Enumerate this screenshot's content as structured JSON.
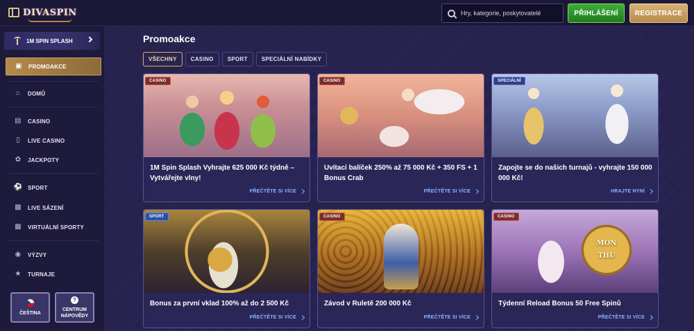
{
  "header": {
    "logo_text": "DIVASPIN",
    "search_placeholder": "Hry, kategorie, poskytovatelé",
    "login_label": "PŘIHLÁŠENÍ",
    "register_label": "REGISTRACE"
  },
  "sidebar": {
    "promo_banner": "1M SPIN SPLASH",
    "items": [
      {
        "label": "PROMOAKCE",
        "icon": "gift-icon"
      },
      {
        "label": "DOMŮ",
        "icon": "home-icon"
      },
      {
        "label": "CASINO",
        "icon": "slot-machine-icon"
      },
      {
        "label": "LIVE CASINO",
        "icon": "live-casino-icon"
      },
      {
        "label": "JACKPOTY",
        "icon": "jackpot-icon"
      },
      {
        "label": "SPORT",
        "icon": "ball-icon"
      },
      {
        "label": "LIVE SÁZENÍ",
        "icon": "live-betting-icon"
      },
      {
        "label": "VIRTUÁLNÍ SPORTY",
        "icon": "virtual-sports-icon"
      },
      {
        "label": "VÝZVY",
        "icon": "challenge-icon"
      },
      {
        "label": "TURNAJE",
        "icon": "trophy-icon"
      }
    ],
    "language_label": "ČEŠTINA",
    "help_label": "CENTRUM NÁPOVĚDY"
  },
  "main": {
    "title": "Promoakce",
    "filters": [
      "VŠECHNY",
      "CASINO",
      "SPORT",
      "SPECIÁLNÍ NABÍDKY"
    ],
    "cards": [
      {
        "badge": "CASINO",
        "title": "1M Spin Splash Vyhrajte 625 000 Kč týdně – Vytvářejte vlny!",
        "cta": "PŘEČTĚTE SI VÍCE"
      },
      {
        "badge": "CASINO",
        "title": "Uvítací balíček 250% až 75 000 Kč + 350 FS + 1 Bonus Crab",
        "cta": "PŘEČTĚTE SI VÍCE"
      },
      {
        "badge": "SPECIÁLNÍ",
        "title": "Zapojte se do našich turnajů - vyhrajte 150 000 000 Kč!",
        "cta": "HRAJTE NYNÍ"
      },
      {
        "badge": "SPORT",
        "title": "Bonus za první vklad 100% až do 2 500 Kč",
        "cta": "PŘEČTĚTE SI VÍCE"
      },
      {
        "badge": "CASINO",
        "title": "Závod v Ruletě 200 000 Kč",
        "cta": "PŘEČTĚTE SI VÍCE"
      },
      {
        "badge": "CASINO",
        "title": "Týdenní Reload Bonus 50 Free Spinů",
        "cta": "PŘEČTĚTE SI VÍCE"
      }
    ],
    "coin_text": "MON THU"
  },
  "colors": {
    "background": "#24204a",
    "accent_gold": "#b58a4a",
    "login_green": "#2f9a2c",
    "link_blue": "#8fb2ff"
  }
}
